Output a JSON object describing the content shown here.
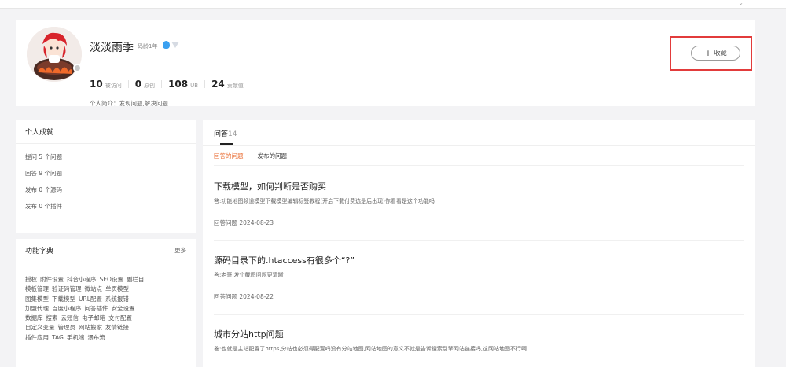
{
  "profile": {
    "username": "淡淡雨季",
    "code_age": "码龄1年",
    "stats": [
      {
        "num": "10",
        "label": "被访问"
      },
      {
        "num": "0",
        "label": "原创"
      },
      {
        "num": "108",
        "label": "UB"
      },
      {
        "num": "24",
        "label": "贡献值"
      }
    ],
    "intro": "个人简介：发现问题,解决问题",
    "fav_label": "收藏",
    "fav_plus": "+"
  },
  "achievements": {
    "title": "个人成就",
    "items": [
      "提问 5 个问题",
      "回答 9 个问题",
      "发布 0 个源码",
      "发布 0 个插件"
    ]
  },
  "dictionary": {
    "title": "功能字典",
    "more": "更多",
    "tags": [
      "授权",
      "附件设置",
      "抖音小程序",
      "SEO设置",
      "副栏目",
      "模板管理",
      "验证码管理",
      "微站点",
      "单页模型",
      "图集模型",
      "下载模型",
      "URL配置",
      "系统报错",
      "加盟代理",
      "百度小程序",
      "问答插件",
      "安全设置",
      "数据库",
      "搜索",
      "云短信",
      "电子邮箱",
      "支付配置",
      "自定义变量",
      "管理员",
      "网站搬家",
      "友情链接",
      "插件应用",
      "TAG",
      "手机端",
      "瀑布流"
    ]
  },
  "qa": {
    "title": "问答",
    "count": "14",
    "tabs": [
      "回答的问题",
      "发布的问题"
    ],
    "items": [
      {
        "title": "下载模型，如何判断是否购买",
        "answer": "答:功能地图频道模型下载模型编辑标签教程(开启下载付费选是后出现)你看看是这个功能吗",
        "date": "回答问题 2024-08-23"
      },
      {
        "title": "源码目录下的.htaccess有很多个“?”",
        "answer": "答:老哥,发个截图问题更清晰",
        "date": "回答问题 2024-08-22"
      },
      {
        "title": "城市分站http问题",
        "answer": "答:也就是主站配置了https,分站也必须得配置吗没有分站地图,网站地图的意义不就是告诉搜索引擎网站链接吗,这网站地图不行啊",
        "date": ""
      }
    ]
  },
  "colors": {
    "accent": "#e96a2f",
    "highlight": "#e23b3b"
  }
}
